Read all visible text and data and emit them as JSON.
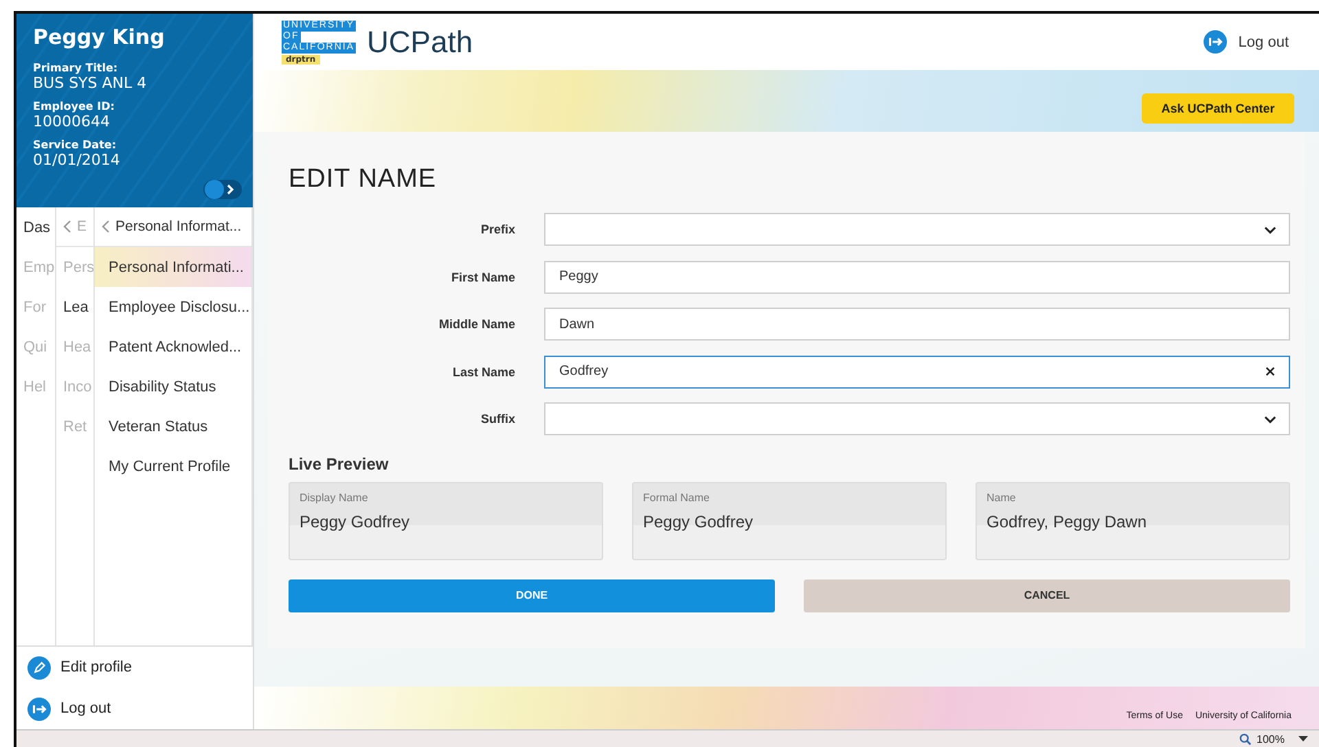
{
  "profile": {
    "name": "Peggy King",
    "fields": [
      {
        "label": "Primary Title:",
        "value": "BUS SYS ANL 4"
      },
      {
        "label": "Employee ID:",
        "value": "10000644"
      },
      {
        "label": "Service Date:",
        "value": "01/01/2014"
      }
    ],
    "sidebar_toggle": {
      "on": false
    }
  },
  "nav": {
    "column_1": [
      {
        "label": "Das",
        "muted": false
      },
      {
        "label": "Emp",
        "muted": true
      },
      {
        "label": "For",
        "muted": true
      },
      {
        "label": "Qui",
        "muted": true
      },
      {
        "label": "Hel",
        "muted": true
      }
    ],
    "column_2": {
      "header": "E",
      "items": [
        {
          "label": "Pers",
          "muted": true
        },
        {
          "label": "Lea",
          "muted": false
        },
        {
          "label": "Hea",
          "muted": true
        },
        {
          "label": "Inco",
          "muted": true
        },
        {
          "label": "Ret",
          "muted": true
        }
      ]
    },
    "column_3": {
      "header": "Personal Informat...",
      "items": [
        {
          "label": "Personal Informati...",
          "selected": true
        },
        {
          "label": "Employee Disclosu...",
          "selected": false
        },
        {
          "label": "Patent Acknowled...",
          "selected": false
        },
        {
          "label": "Disability Status",
          "selected": false
        },
        {
          "label": "Veteran Status",
          "selected": false
        },
        {
          "label": "My Current Profile",
          "selected": false
        }
      ]
    }
  },
  "sidebar_actions": [
    {
      "label": "Edit profile",
      "kind": "edit"
    },
    {
      "label": "Log out",
      "kind": "logout"
    }
  ],
  "header": {
    "logo": {
      "lines": [
        "UNIVERSITY",
        "OF",
        "CALIFORNIA"
      ],
      "tag": "drptrn"
    },
    "app_name": "UCPath",
    "logout": "Log out"
  },
  "ask_button": "Ask UCPath Center",
  "form": {
    "title": "EDIT NAME",
    "fields": [
      {
        "label": "Prefix",
        "kind": "select",
        "focused": false
      },
      {
        "label": "First Name",
        "kind": "text",
        "value": "Peggy",
        "focused": false
      },
      {
        "label": "Middle Name",
        "kind": "text",
        "value": "Dawn",
        "focused": false
      },
      {
        "label": "Last Name",
        "kind": "text",
        "value": "Godfrey",
        "focused": true
      },
      {
        "label": "Suffix",
        "kind": "select",
        "focused": false
      }
    ]
  },
  "preview": {
    "title": "Live Preview",
    "cards": [
      {
        "label": "Display Name",
        "value": "Peggy Godfrey"
      },
      {
        "label": "Formal Name",
        "value": "Peggy Godfrey"
      },
      {
        "label": "Name",
        "value": "Godfrey, Peggy Dawn"
      }
    ]
  },
  "buttons": [
    {
      "label": "DONE",
      "kind": "primary"
    },
    {
      "label": "CANCEL",
      "kind": "secondary"
    }
  ],
  "footer": {
    "links": [
      "Terms of Use",
      "University of California"
    ]
  },
  "status_bar": {
    "zoom": "100%"
  }
}
